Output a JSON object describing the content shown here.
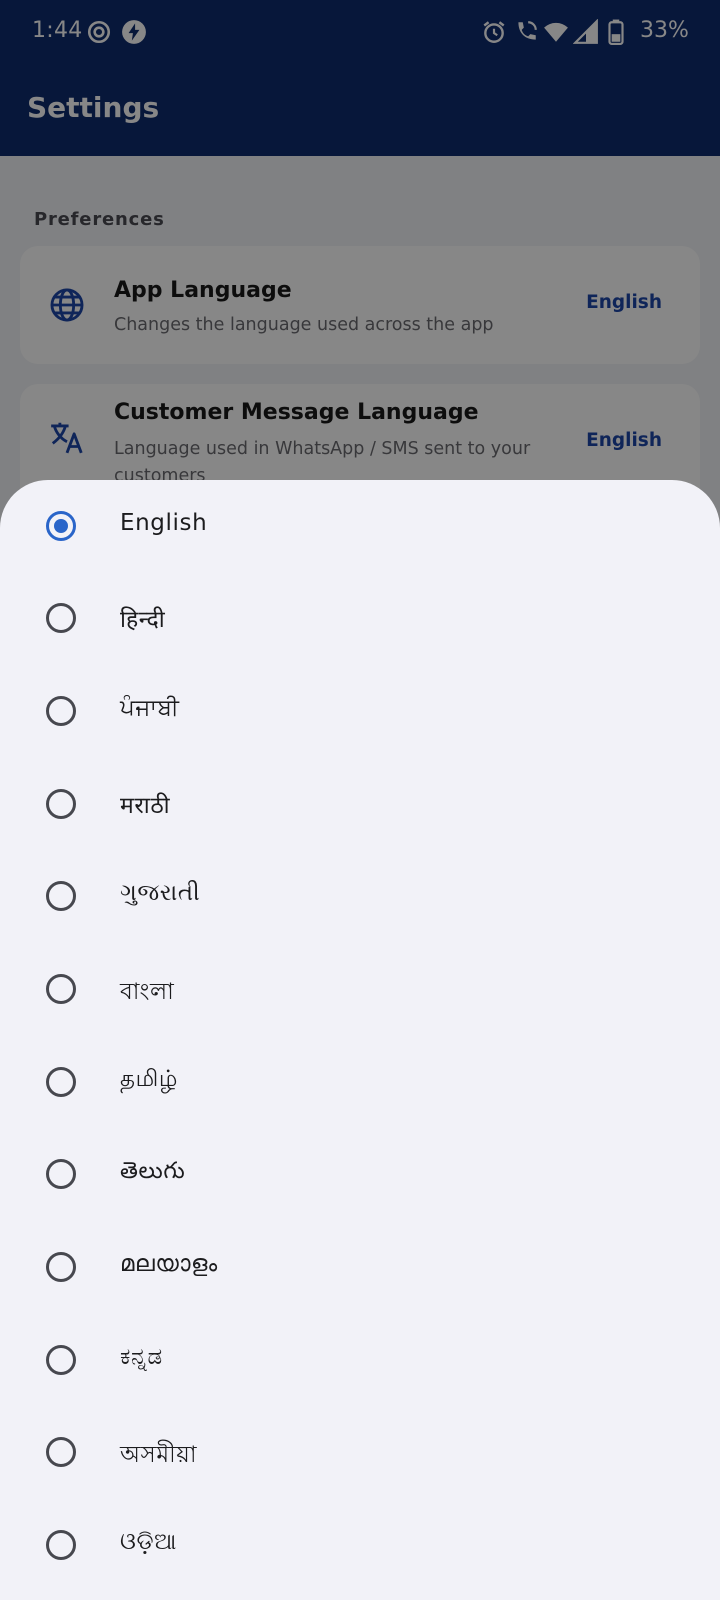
{
  "status_bar": {
    "time": "1:44",
    "battery": "33%",
    "icons": [
      "camera-status-icon",
      "bolt-icon",
      "alarm-icon",
      "wifi-calling-icon",
      "wifi-icon",
      "cell-signal-icon",
      "battery-icon"
    ]
  },
  "app_bar": {
    "title": "Settings"
  },
  "settings": {
    "section_header": "Preferences",
    "items": [
      {
        "icon": "globe-icon",
        "title": "App Language",
        "subtitle": "Changes the language used across the app",
        "value": "English"
      },
      {
        "icon": "translate-icon",
        "title": "Customer Message Language",
        "subtitle": "Language used in WhatsApp / SMS sent to your customers",
        "value": "English"
      }
    ]
  },
  "language_sheet": {
    "selected": "English",
    "options": [
      "English",
      "हिन्दी",
      "ਪੰਜਾਬੀ",
      "मराठी",
      "ગુજરાતી",
      "বাংলা",
      "தமிழ்",
      "తెలుగు",
      "മലയാളം",
      "ಕನ್ನಡ",
      "অসমীয়া",
      "ଓଡ଼ିଆ"
    ]
  },
  "colors": {
    "app_bar": "#0f2c6e",
    "accent": "#2a65c9",
    "value_text": "#1e47a8",
    "sheet_bg": "#f2f2f8"
  }
}
